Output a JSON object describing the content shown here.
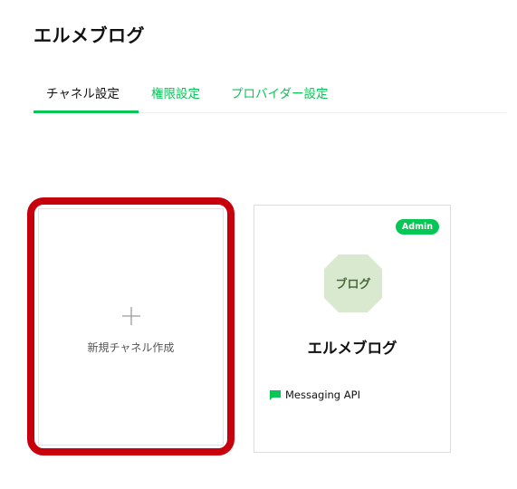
{
  "header": {
    "title": "エルメブログ"
  },
  "tabs": [
    {
      "label": "チャネル設定",
      "active": true
    },
    {
      "label": "権限設定",
      "active": false
    },
    {
      "label": "プロバイダー設定",
      "active": false
    }
  ],
  "new_channel": {
    "label": "新規チャネル作成",
    "icon": "plus-icon"
  },
  "channels": [
    {
      "badge": "Admin",
      "icon_text": "ブログ",
      "name": "エルメブログ",
      "product": "Messaging API",
      "product_icon": "chat-bubble-icon"
    }
  ],
  "colors": {
    "accent": "#06c755",
    "highlight": "#c8000c",
    "channel_icon_bg": "#d9e9cf",
    "channel_icon_text": "#4a6a3a"
  }
}
